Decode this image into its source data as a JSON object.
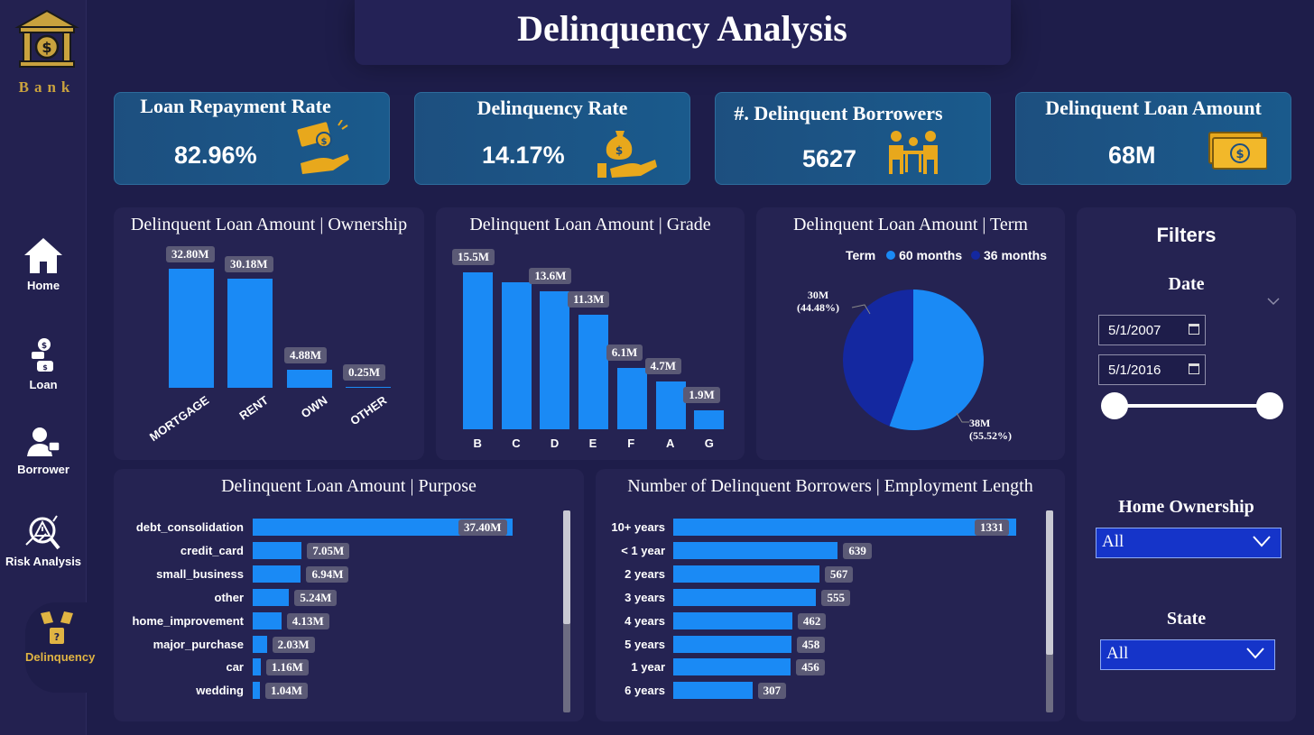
{
  "app": {
    "logo_text": "Bank",
    "title": "Delinquency Analysis"
  },
  "nav": [
    {
      "label": "Home",
      "icon": "home-icon"
    },
    {
      "label": "Loan",
      "icon": "loan-icon"
    },
    {
      "label": "Borrower",
      "icon": "borrower-icon"
    },
    {
      "label": "Risk Analysis",
      "icon": "risk-analysis-icon"
    },
    {
      "label": "Delinquency",
      "icon": "delinquency-icon",
      "active": true
    }
  ],
  "kpis": [
    {
      "title": "Loan Repayment Rate",
      "value": "82.96%",
      "icon": "money-hand-icon"
    },
    {
      "title": "Delinquency Rate",
      "value": "14.17%",
      "icon": "money-bag-hand-icon"
    },
    {
      "title": "#. Delinquent Borrowers",
      "value": "5627",
      "icon": "borrowers-table-icon"
    },
    {
      "title": "Delinquent Loan Amount",
      "value": "68M",
      "icon": "cash-bill-icon"
    }
  ],
  "colors": {
    "accent_gold": "#e0b443",
    "bar_blue": "#1a8af5",
    "term_60": "#1a8af5",
    "term_36": "#1428a0"
  },
  "charts": {
    "ownership": {
      "title": "Delinquent Loan Amount | Ownership"
    },
    "grade": {
      "title": "Delinquent Loan Amount | Grade"
    },
    "term": {
      "title": "Delinquent Loan Amount | Term",
      "legend_title": "Term",
      "label_60": "38M",
      "pct_60": "(55.52%)",
      "label_36": "30M",
      "pct_36": "(44.48%)"
    },
    "purpose": {
      "title": "Delinquent Loan Amount | Purpose"
    },
    "employment": {
      "title": "Number of Delinquent Borrowers | Employment Length"
    }
  },
  "chart_data": [
    {
      "type": "bar",
      "title": "Delinquent Loan Amount | Ownership",
      "categories": [
        "MORTGAGE",
        "RENT",
        "OWN",
        "OTHER"
      ],
      "values": [
        32.8,
        30.18,
        4.88,
        0.25
      ],
      "labels": [
        "32.80M",
        "30.18M",
        "4.88M",
        "0.25M"
      ]
    },
    {
      "type": "bar",
      "title": "Delinquent Loan Amount | Grade",
      "categories": [
        "B",
        "C",
        "D",
        "E",
        "F",
        "A",
        "G"
      ],
      "values": [
        15.5,
        14.5,
        13.6,
        11.3,
        6.1,
        4.7,
        1.9
      ],
      "labels": [
        "15.5M",
        "",
        "13.6M",
        "11.3M",
        "6.1M",
        "4.7M",
        "1.9M"
      ]
    },
    {
      "type": "pie",
      "title": "Delinquent Loan Amount | Term",
      "legend_title": "Term",
      "legend_position": "top",
      "series": [
        {
          "name": "60 months",
          "value": 38,
          "percent": 55.52,
          "label": "38M"
        },
        {
          "name": "36 months",
          "value": 30,
          "percent": 44.48,
          "label": "30M"
        }
      ]
    },
    {
      "type": "bar",
      "orientation": "horizontal",
      "title": "Delinquent Loan Amount | Purpose",
      "categories": [
        "debt_consolidation",
        "credit_card",
        "small_business",
        "other",
        "home_improvement",
        "major_purchase",
        "car",
        "wedding"
      ],
      "values": [
        37.4,
        7.05,
        6.94,
        5.24,
        4.13,
        2.03,
        1.16,
        1.04
      ],
      "labels": [
        "37.40M",
        "7.05M",
        "6.94M",
        "5.24M",
        "4.13M",
        "2.03M",
        "1.16M",
        "1.04M"
      ]
    },
    {
      "type": "bar",
      "orientation": "horizontal",
      "title": "Number of Delinquent Borrowers | Employment Length",
      "categories": [
        "10+ years",
        "< 1 year",
        "2 years",
        "3 years",
        "4 years",
        "5 years",
        "1 year",
        "6 years"
      ],
      "values": [
        1331,
        639,
        567,
        555,
        462,
        458,
        456,
        307
      ],
      "labels": [
        "1331",
        "639",
        "567",
        "555",
        "462",
        "458",
        "456",
        "307"
      ]
    }
  ],
  "filters": {
    "title": "Filters",
    "date_title": "Date",
    "date_start": "5/1/2007",
    "date_end": "5/1/2016",
    "slider": {
      "start": 0,
      "end": 1
    },
    "home_ownership_title": "Home Ownership",
    "home_ownership_value": "All",
    "state_title": "State",
    "state_value": "All"
  }
}
